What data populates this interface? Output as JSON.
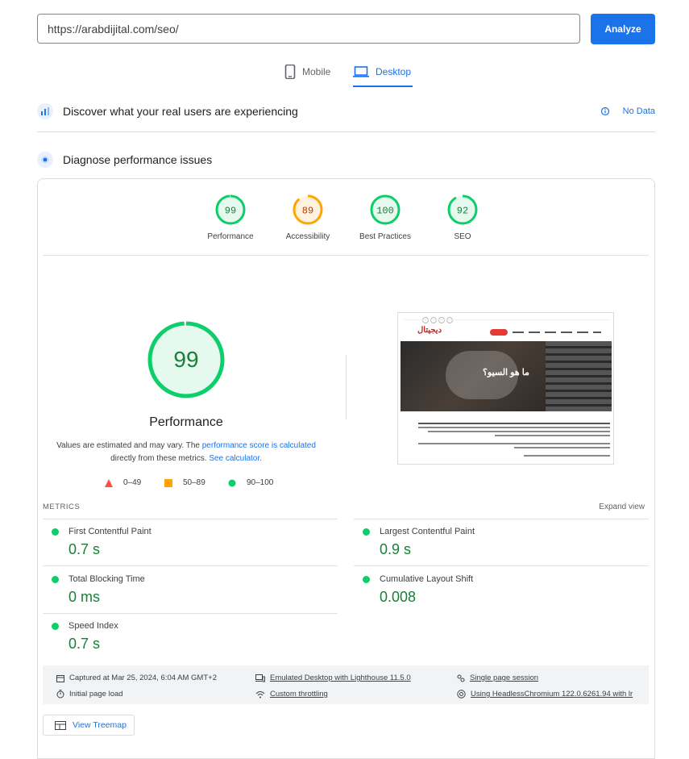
{
  "search": {
    "url_value": "https://arabdijital.com/seo/",
    "analyze_label": "Analyze"
  },
  "tabs": [
    {
      "label": "Mobile",
      "icon": "phone-icon",
      "active": false
    },
    {
      "label": "Desktop",
      "icon": "laptop-icon",
      "active": true
    }
  ],
  "field_data": {
    "title": "Discover what your real users are experiencing",
    "status": "No Data"
  },
  "diagnose": {
    "title": "Diagnose performance issues"
  },
  "categories": [
    {
      "score": "99",
      "label": "Performance",
      "color": "#0cce6b",
      "fraction": 0.99
    },
    {
      "score": "89",
      "label": "Accessibility",
      "color": "#ffa400",
      "fraction": 0.89
    },
    {
      "score": "100",
      "label": "Best Practices",
      "color": "#0cce6b",
      "fraction": 1.0
    },
    {
      "score": "92",
      "label": "SEO",
      "color": "#0cce6b",
      "fraction": 0.92
    }
  ],
  "main_score": {
    "score": "99",
    "label": "Performance",
    "fraction": 0.99
  },
  "explanation": {
    "part1": "Values are estimated and may vary. The ",
    "link1": "performance score is calculated",
    "part2": " directly from these metrics. ",
    "link2": "See calculator."
  },
  "legend": [
    {
      "range": "0–49",
      "color": "#ff4e42"
    },
    {
      "range": "50–89",
      "color": "#ffa400"
    },
    {
      "range": "90–100",
      "color": "#0cce6b"
    }
  ],
  "screenshot": {
    "heading": "ما هو السيو؟",
    "logo": "ديجيتال"
  },
  "metrics_header": {
    "title": "METRICS",
    "expand": "Expand view"
  },
  "metrics": [
    {
      "name": "First Contentful Paint",
      "value": "0.7 s"
    },
    {
      "name": "Largest Contentful Paint",
      "value": "0.9 s"
    },
    {
      "name": "Total Blocking Time",
      "value": "0 ms"
    },
    {
      "name": "Cumulative Layout Shift",
      "value": "0.008"
    },
    {
      "name": "Speed Index",
      "value": "0.7 s"
    }
  ],
  "run_info": {
    "captured": "Captured at Mar 25, 2024, 6:04 AM GMT+2",
    "emulated": "Emulated Desktop with Lighthouse 11.5.0",
    "session": "Single page session",
    "load": "Initial page load",
    "throttling": "Custom throttling",
    "browser": "Using HeadlessChromium 122.0.6261.94 with lr"
  },
  "treemap": {
    "label": "View Treemap"
  },
  "colors": {
    "accent": "#1a73e8",
    "pass": "#0cce6b",
    "average": "#ffa400",
    "fail": "#ff4e42",
    "pass_text": "#188038"
  }
}
